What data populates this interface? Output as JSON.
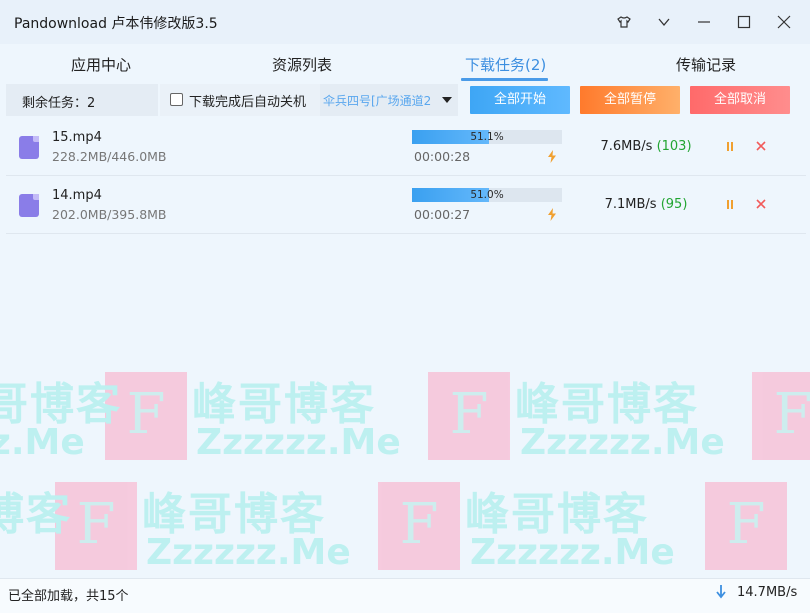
{
  "window": {
    "title": "Pandownload 卢本伟修改版3.5"
  },
  "tabs": [
    {
      "label": "应用中心"
    },
    {
      "label": "资源列表"
    },
    {
      "label": "下载任务(2)"
    },
    {
      "label": "传输记录"
    }
  ],
  "toolbar": {
    "remaining": "剩余任务：2",
    "shutdown_label": "下载完成后自动关机",
    "shutdown_checked": false,
    "channel": "伞兵四号[广场通道2",
    "start_all": "全部开始",
    "pause_all": "全部暂停",
    "cancel_all": "全部取消"
  },
  "tasks": [
    {
      "name": "15.mp4",
      "size": "228.2MB/446.0MB",
      "progress_text": "51.1%",
      "progress": 0.511,
      "time_left": "00:00:28",
      "speed": "7.6MB/s",
      "connections": "(103)"
    },
    {
      "name": "14.mp4",
      "size": "202.0MB/395.8MB",
      "progress_text": "51.0%",
      "progress": 0.51,
      "time_left": "00:00:27",
      "speed": "7.1MB/s",
      "connections": "(95)"
    }
  ],
  "watermark": {
    "cn": "峰哥博客",
    "en": "Zzzzzz.Me",
    "logo": "F"
  },
  "status": {
    "text": "已全部加载，共15个",
    "total_speed": "14.7MB/s"
  },
  "colors": {
    "accent": "#3d8fe0",
    "start": "#3ea6f5",
    "pause": "#ff7a2c",
    "cancel": "#ff6a6a",
    "icon_purple": "#8a7de8",
    "green": "#22a532"
  }
}
